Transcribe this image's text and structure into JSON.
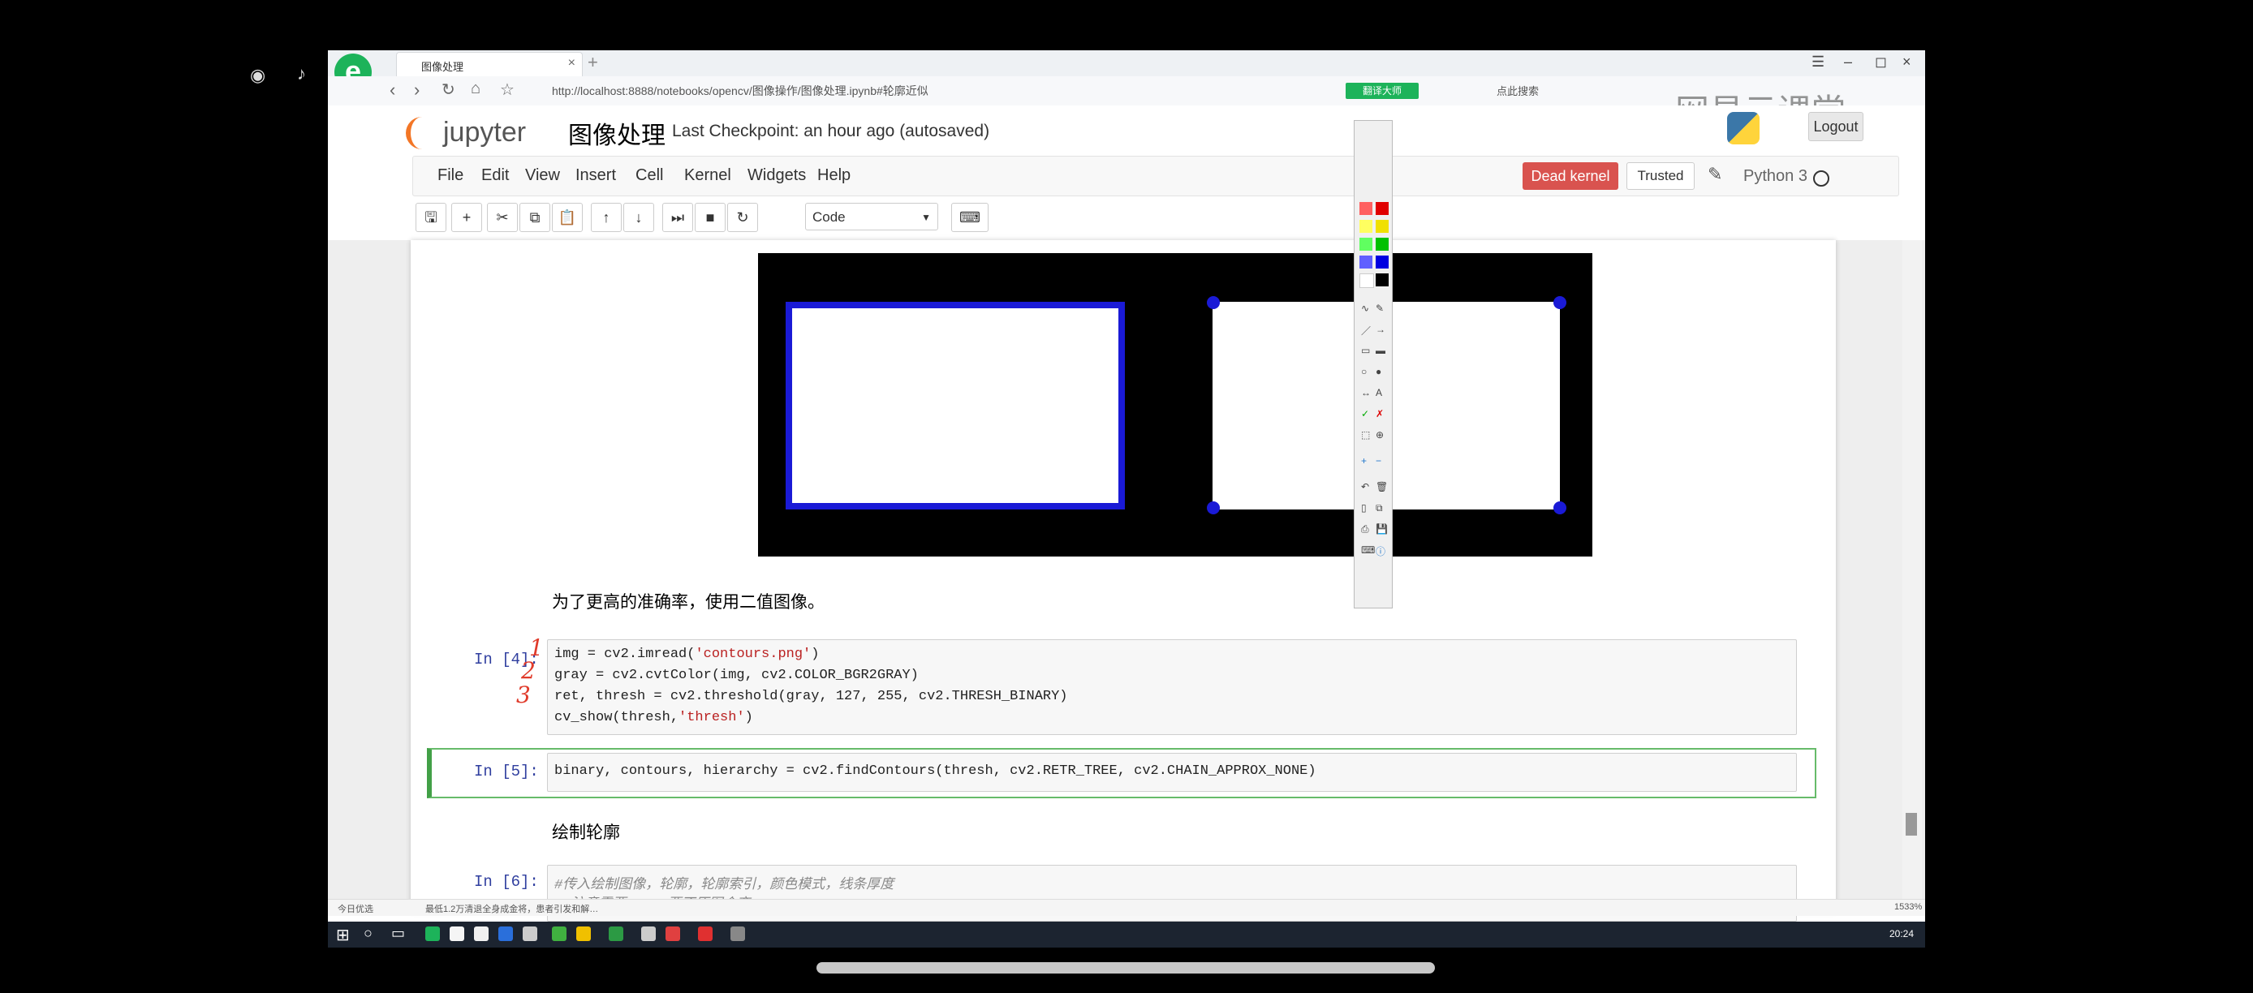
{
  "browser": {
    "tab_title": "图像处理",
    "url": "http://localhost:8888/notebooks/opencv/图像操作/图像处理.ipynb#轮廓近似",
    "translate_label": "翻译大师",
    "search_label": "点此搜索",
    "watermark": "网易云课堂"
  },
  "jupyter": {
    "logo_text": "jupyter",
    "notebook_name": "图像处理",
    "checkpoint": "Last Checkpoint: an hour ago (autosaved)",
    "logout": "Logout",
    "menu": [
      "File",
      "Edit",
      "View",
      "Insert",
      "Cell",
      "Kernel",
      "Widgets",
      "Help"
    ],
    "dead_kernel": "Dead kernel",
    "trusted": "Trusted",
    "kernel_name": "Python 3",
    "cell_type": "Code"
  },
  "cells": {
    "markdown1": "为了更高的准确率，使用二值图像。",
    "cell4": {
      "prompt": "In [4]:",
      "lines": [
        "img = cv2.imread('contours.png')",
        "gray = cv2.cvtColor(img, cv2.COLOR_BGR2GRAY)",
        "ret, thresh = cv2.threshold(gray, 127, 255, cv2.THRESH_BINARY)",
        "cv_show(thresh,'thresh')"
      ],
      "annotations": [
        "1",
        "2",
        "3"
      ]
    },
    "cell5": {
      "prompt": "In [5]:",
      "code": "binary, contours, hierarchy = cv2.findContours(thresh, cv2.RETR_TREE, cv2.CHAIN_APPROX_NONE)"
    },
    "markdown2": "绘制轮廓",
    "cell6": {
      "prompt": "In [6]:",
      "comment": "#传入绘制图像，轮廓，轮廓索引，颜色模式，线条厚度",
      "comment2": "# 注意需要copy,要不原图会变。。。"
    }
  },
  "statusbar": {
    "left": "今日优选",
    "news": "最低1.2万清退全身成金将，患者引发和解…",
    "speed": "1533%"
  },
  "taskbar": {
    "time": "20:24"
  },
  "colors": {
    "dead_kernel": "#d9534f",
    "selected_cell": "#66bb6a",
    "contour_blue": "#1a1ad6",
    "prompt_blue": "#303f9f"
  }
}
